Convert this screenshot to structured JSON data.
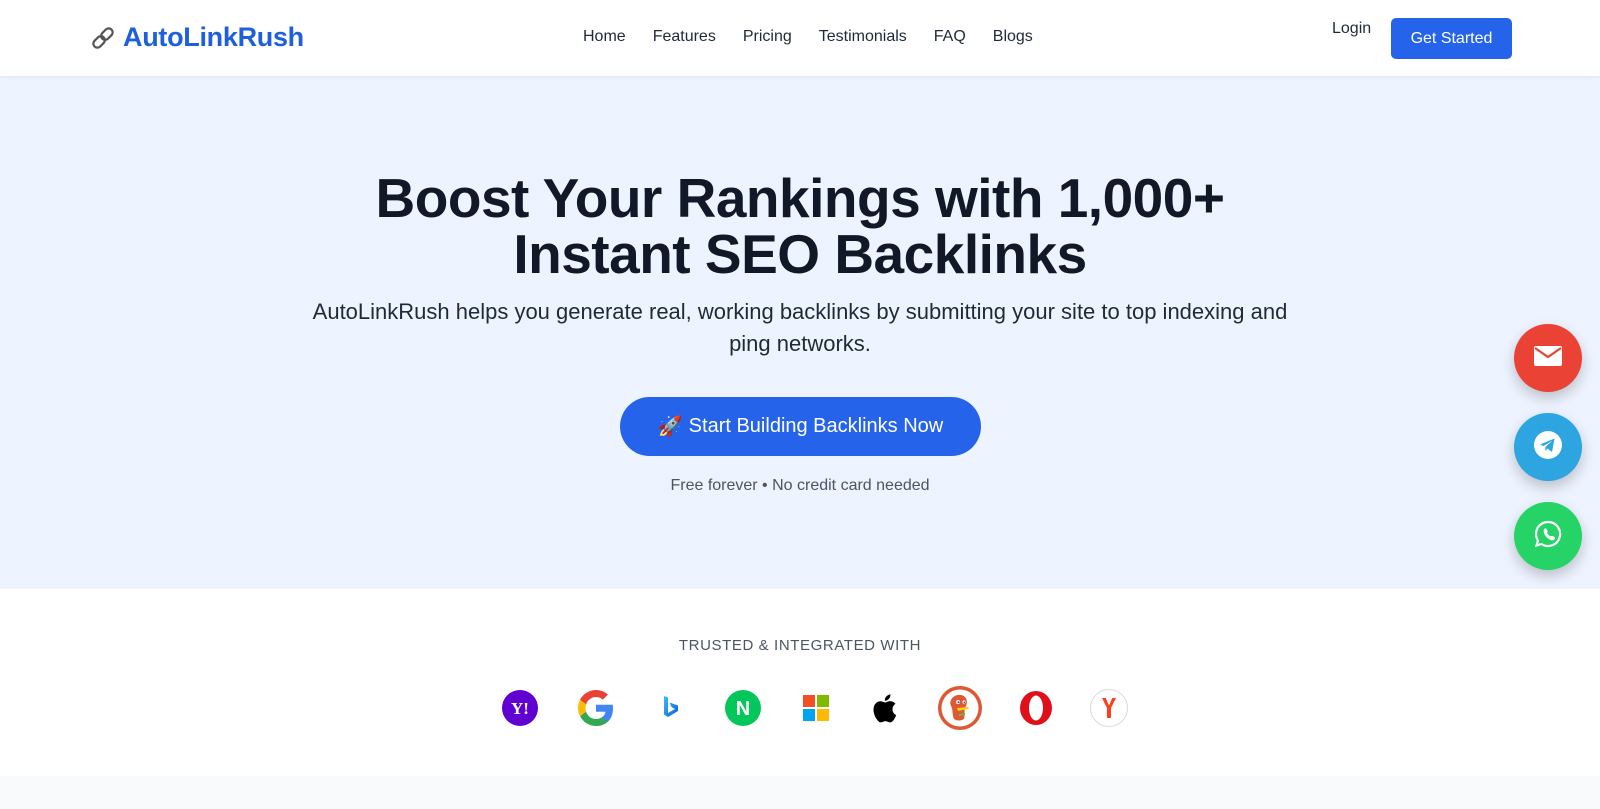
{
  "header": {
    "logo_text": "AutoLinkRush",
    "logo_icon": "link-icon",
    "nav": [
      "Home",
      "Features",
      "Pricing",
      "Testimonials",
      "FAQ",
      "Blogs"
    ],
    "login_label": "Login",
    "cta_label": "Get Started"
  },
  "hero": {
    "title_line1": "Boost Your Rankings with 1,000+",
    "title_line2": "Instant SEO Backlinks",
    "subtitle": "AutoLinkRush helps you generate real, working backlinks by submitting your site to top indexing and ping networks.",
    "cta_emoji": "🚀",
    "cta_label": "Start Building Backlinks Now",
    "note": "Free forever • No credit card needed"
  },
  "trusted": {
    "label": "TRUSTED & INTEGRATED WITH",
    "brands": [
      "yahoo-icon",
      "google-icon",
      "bing-icon",
      "naver-icon",
      "microsoft-icon",
      "apple-icon",
      "duckduckgo-icon",
      "opera-icon",
      "yandex-icon"
    ],
    "yahoo_text": "Y!",
    "naver_text": "N"
  },
  "floating": [
    "email-icon",
    "telegram-icon",
    "whatsapp-icon"
  ],
  "colors": {
    "brand": "#1d5fdc",
    "primary": "#2563eb",
    "hero_bg": "#eef4ff",
    "email": "#ea4335",
    "telegram": "#2ca5e0",
    "whatsapp": "#25d366"
  }
}
